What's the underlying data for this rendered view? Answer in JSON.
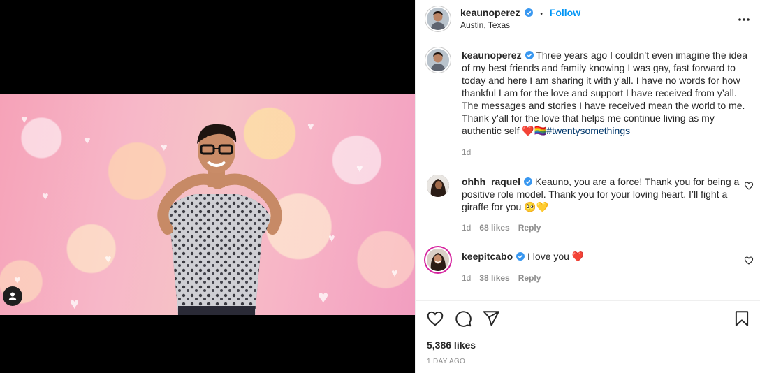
{
  "post": {
    "author": "keaunoperez",
    "follow_label": "Follow",
    "dot": "•",
    "location": "Austin, Texas"
  },
  "caption": {
    "author": "keaunoperez",
    "text": "Three years ago I couldn’t even imagine the idea of my best friends and family knowing I was gay, fast forward to today and here I am sharing it with y’all. I have no words for how thankful I am for the love and support I have received from y’all. The messages and stories I have received mean the world to me. Thank y’all for the love that helps me continue living as my authentic self",
    "emoji": "❤️🏳️‍🌈",
    "hashtag": "#twentysomethings",
    "time": "1d"
  },
  "comments": [
    {
      "author": "ohhh_raquel",
      "text": "Keauno, you are a force! Thank you for being a positive role model. Thank you for your loving heart. I’ll fight a giraffe for you 🥺💛",
      "time": "1d",
      "likes": "68 likes",
      "reply": "Reply"
    },
    {
      "author": "keepitcabo",
      "text": "I love you ❤️",
      "time": "1d",
      "likes": "38 likes",
      "reply": "Reply"
    }
  ],
  "footer": {
    "likes": "5,386 likes",
    "posted": "1 DAY AGO"
  },
  "icons": {
    "more": "more-options-icon",
    "like": "heart-icon",
    "comment": "comment-icon",
    "share": "share-icon",
    "save": "bookmark-icon",
    "verified": "verified-badge-icon",
    "user_tag": "user-tag-icon"
  },
  "colors": {
    "accent": "#0095f6",
    "verified": "#3897f0",
    "text": "#262626",
    "muted": "#8e8e8e",
    "hashtag": "#00376b"
  }
}
